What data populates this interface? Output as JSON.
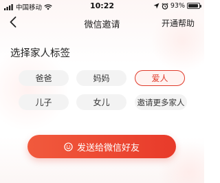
{
  "status_bar": {
    "carrier": "中国移动",
    "time": "10:22",
    "battery_percent": "93%",
    "battery_level": 0.93,
    "icons": [
      "signal-icon",
      "wifi-icon",
      "location-icon",
      "alarm-icon",
      "battery-icon"
    ]
  },
  "nav": {
    "back_icon": "chevron-left-icon",
    "title": "微信邀请",
    "help_label": "开通帮助"
  },
  "section": {
    "title": "选择家人标签"
  },
  "tags": [
    {
      "label": "爸爸",
      "selected": false
    },
    {
      "label": "妈妈",
      "selected": false
    },
    {
      "label": "爱人",
      "selected": true
    },
    {
      "label": "儿子",
      "selected": false
    },
    {
      "label": "女儿",
      "selected": false
    },
    {
      "label": "邀请更多家人",
      "selected": false
    }
  ],
  "send_button": {
    "icon": "smile-icon",
    "label": "发送给微信好友"
  },
  "colors": {
    "accent": "#e83a2a",
    "tag_bg": "#f3f3f3",
    "selected_bg": "#fff3f1"
  }
}
